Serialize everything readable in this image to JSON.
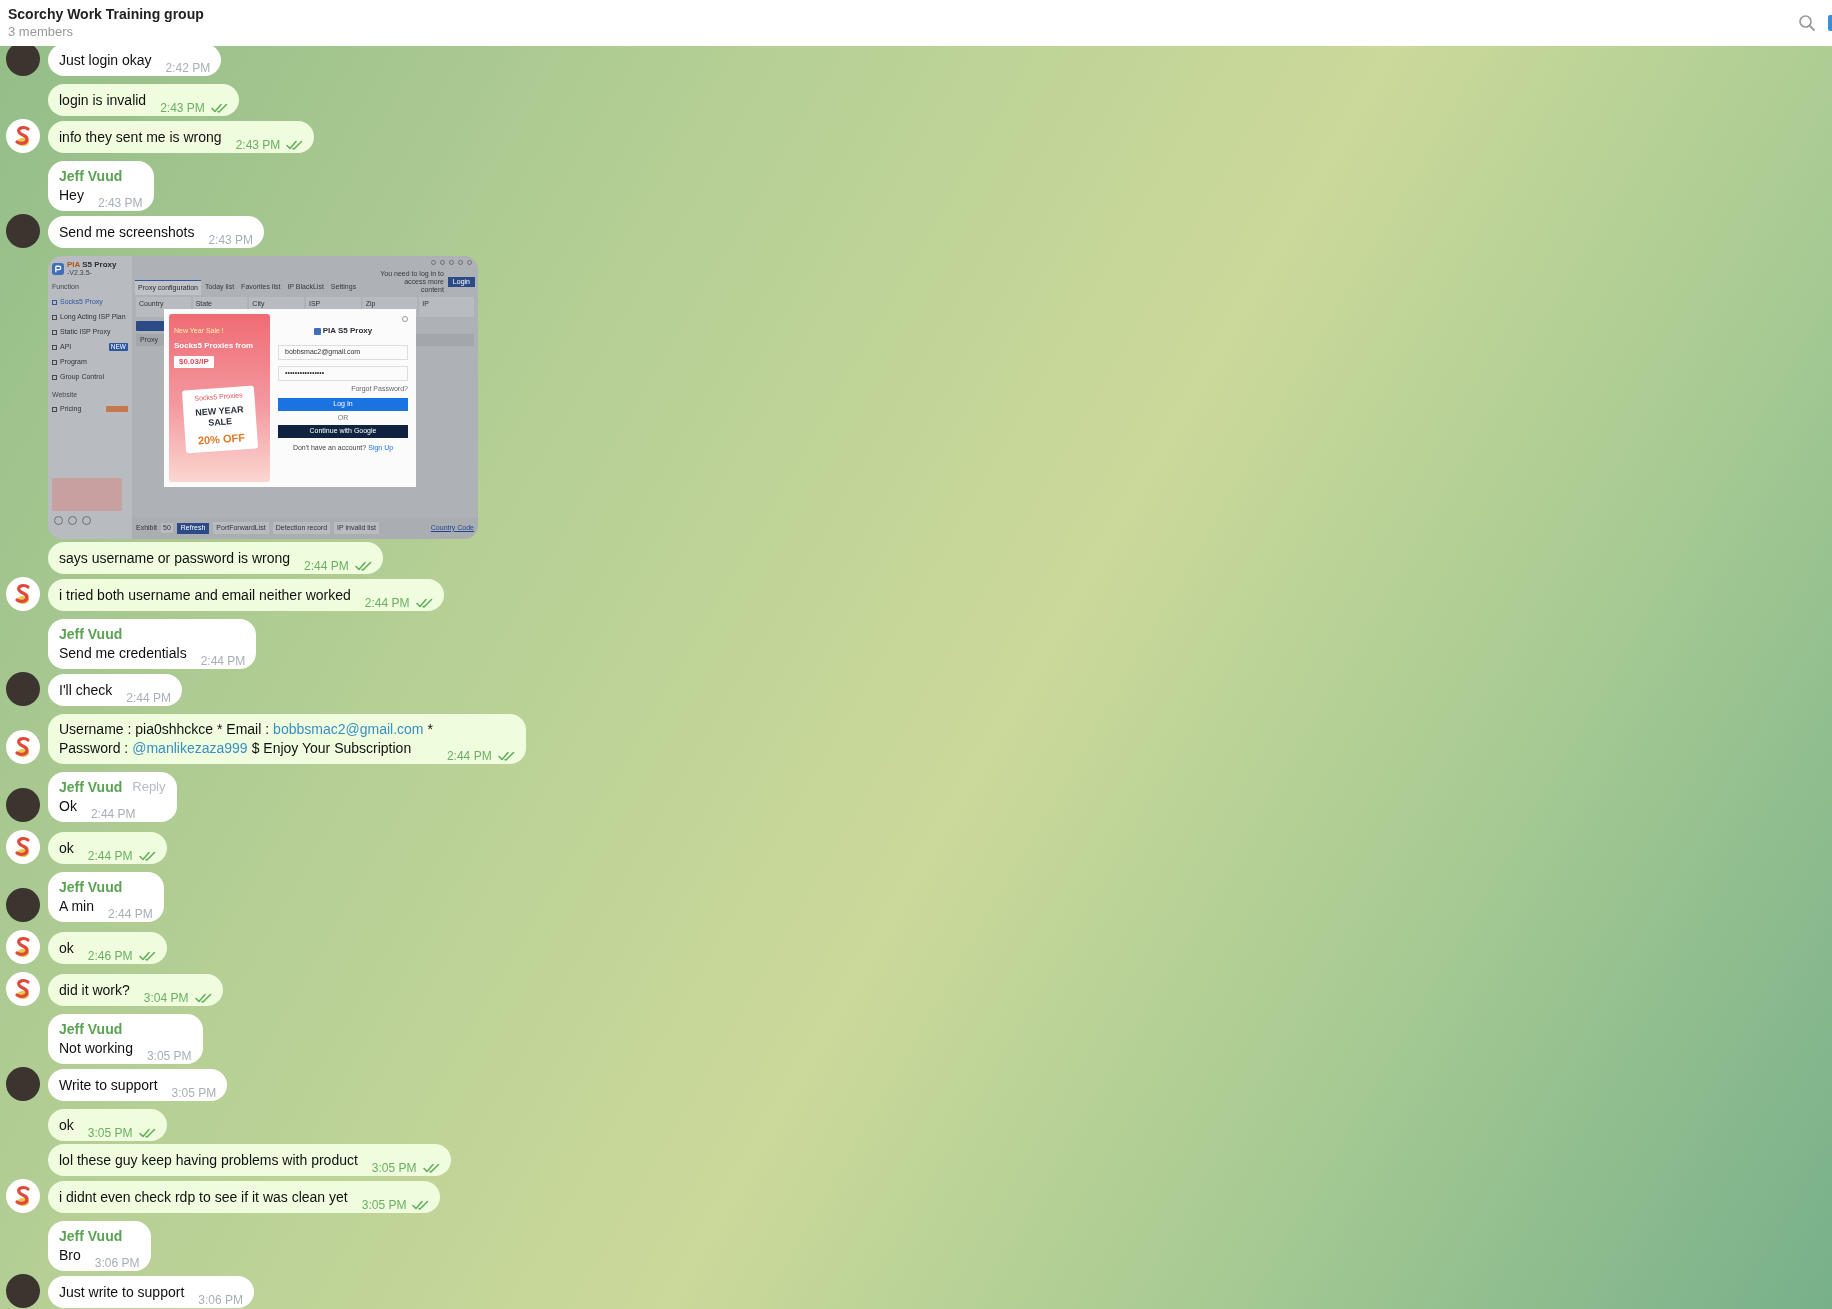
{
  "header": {
    "title": "Scorchy Work Training group",
    "subtitle": "3 members"
  },
  "messages": [
    {
      "kind": "text",
      "out": false,
      "avatar": true,
      "text": "Just login okay",
      "time": "2:42 PM"
    },
    {
      "kind": "text",
      "out": true,
      "read": true,
      "avatar": false,
      "text": "login is invalid",
      "time": "2:43 PM"
    },
    {
      "kind": "text",
      "out": true,
      "read": true,
      "avatar": true,
      "text": "info they sent me is wrong",
      "time": "2:43 PM"
    },
    {
      "kind": "text",
      "out": false,
      "avatar": false,
      "name": "Jeff Vuud",
      "text": "Hey",
      "time": "2:43 PM"
    },
    {
      "kind": "text",
      "out": false,
      "avatar": true,
      "text": "Send me screenshots",
      "time": "2:43 PM"
    },
    {
      "kind": "screenshot",
      "out": true,
      "avatar": false,
      "shot": {
        "app_name": "PIA S5 Proxy",
        "version": "-V2.3.5-",
        "section_label": "Function",
        "nav": [
          {
            "label": "Socks5 Proxy",
            "selected": true
          },
          {
            "label": "Long Acting ISP Plan",
            "selected": false
          },
          {
            "label": "Static ISP Proxy",
            "selected": false
          },
          {
            "label": "API",
            "selected": false,
            "badge": "NEW"
          },
          {
            "label": "Program",
            "selected": false
          },
          {
            "label": "Group Control",
            "selected": false
          }
        ],
        "website_label": "Website",
        "pricing": "Pricing",
        "tabs": [
          {
            "label": "Proxy configuration",
            "selected": true
          },
          {
            "label": "Today list",
            "selected": false
          },
          {
            "label": "Favorites list",
            "selected": false
          },
          {
            "label": "IP BlackList",
            "selected": false
          },
          {
            "label": "Settings",
            "selected": false
          }
        ],
        "login_notice": "You need to log in to access more content",
        "login_button": "Login",
        "filters": [
          "Country",
          "State",
          "City",
          "ISP",
          "Zip",
          "IP"
        ],
        "table_column": "Proxy",
        "exhibit": "Exhibit",
        "page_size": "50",
        "refresh": "Refresh",
        "bottom_buttons": [
          "PortForwardList",
          "Detection record",
          "IP invalid list"
        ],
        "country_code": "Country Code",
        "modal": {
          "sale_tag": "New Year Sale !",
          "headline": "Socks5 Proxies from",
          "price": "$0.03/IP",
          "card_title": "Socks5 Proxies",
          "card_sale": "NEW YEAR SALE",
          "card_discount": "20% OFF",
          "brand": "PIA S5 Proxy",
          "email": "bobbsmac2@gmail.com",
          "password": "••••••••••••••••",
          "forgot": "Forgot Password?",
          "login": "Log In",
          "divider": "OR",
          "google": "Continue with Google",
          "signup_prompt": "Don't have an account?",
          "signup": "Sign Up"
        }
      }
    },
    {
      "kind": "text",
      "out": true,
      "read": true,
      "avatar": false,
      "text": "says username or password is wrong",
      "time": "2:44 PM"
    },
    {
      "kind": "text",
      "out": true,
      "read": true,
      "avatar": true,
      "text": "i tried both username and email neither worked",
      "time": "2:44 PM"
    },
    {
      "kind": "text",
      "out": false,
      "avatar": false,
      "name": "Jeff Vuud",
      "text": "Send me credentials",
      "time": "2:44 PM"
    },
    {
      "kind": "text",
      "out": false,
      "avatar": true,
      "text": "I'll check",
      "time": "2:44 PM"
    },
    {
      "kind": "rich",
      "out": true,
      "read": true,
      "avatar": true,
      "time": "2:44 PM",
      "lines": [
        [
          {
            "kind": "plain",
            "text": "Username : pia0shhckce * Email :"
          },
          {
            "kind": "link",
            "text": "bobbsmac2@gmail.com"
          },
          {
            "kind": "plain",
            "text": "*"
          }
        ],
        [
          {
            "kind": "plain",
            "text": "Password :"
          },
          {
            "kind": "link",
            "text": "@manlikezaza999"
          },
          {
            "kind": "plain",
            "text": "$ Enjoy Your Subscription"
          }
        ]
      ]
    },
    {
      "kind": "text",
      "out": false,
      "avatar": true,
      "name": "Jeff Vuud",
      "action": "Reply",
      "text": "Ok",
      "time": "2:44 PM"
    },
    {
      "kind": "text",
      "out": true,
      "read": true,
      "avatar": true,
      "text": "ok",
      "time": "2:44 PM"
    },
    {
      "kind": "text",
      "out": false,
      "avatar": true,
      "name": "Jeff Vuud",
      "text": "A min",
      "time": "2:44 PM"
    },
    {
      "kind": "text",
      "out": true,
      "read": true,
      "avatar": true,
      "text": "ok",
      "time": "2:46 PM"
    },
    {
      "kind": "text",
      "out": true,
      "read": true,
      "avatar": true,
      "text": "did it work?",
      "time": "3:04 PM"
    },
    {
      "kind": "text",
      "out": false,
      "avatar": false,
      "name": "Jeff Vuud",
      "text": "Not working",
      "time": "3:05 PM"
    },
    {
      "kind": "text",
      "out": false,
      "avatar": true,
      "text": "Write to support",
      "time": "3:05 PM"
    },
    {
      "kind": "text",
      "out": true,
      "read": true,
      "avatar": false,
      "text": "ok",
      "time": "3:05 PM"
    },
    {
      "kind": "text",
      "out": true,
      "read": true,
      "avatar": false,
      "text": "lol these guy keep having problems with product",
      "time": "3:05 PM"
    },
    {
      "kind": "text",
      "out": true,
      "read": true,
      "avatar": true,
      "text": "i didnt even check rdp to see if it was clean yet",
      "time": "3:05 PM"
    },
    {
      "kind": "text",
      "out": false,
      "avatar": false,
      "name": "Jeff Vuud",
      "text": "Bro",
      "time": "3:06 PM"
    },
    {
      "kind": "text",
      "out": false,
      "avatar": true,
      "text": "Just write to support",
      "time": "3:06 PM"
    }
  ]
}
